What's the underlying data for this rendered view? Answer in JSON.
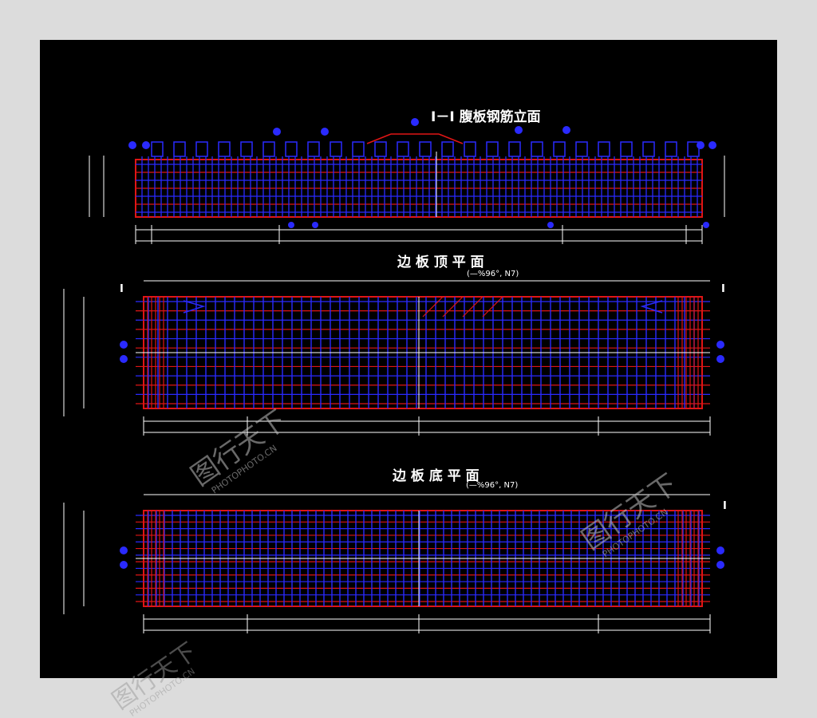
{
  "drawing": {
    "background": "#000000",
    "page_background": "#dcdcdc",
    "colors": {
      "rebar_blue": "#2a2aff",
      "rebar_red": "#e01515",
      "dim_white": "#ffffff",
      "centerline": "#ffffff"
    },
    "views": [
      {
        "id": "elevation",
        "title": "I－I 腹板钢筋立面",
        "subtitle": ""
      },
      {
        "id": "top-plan",
        "title": "边 板 顶 平 面",
        "subtitle": "(—%96°, N7)"
      },
      {
        "id": "bottom-plan",
        "title": "边 板 底 平 面",
        "subtitle": "(—%96°, N7)"
      }
    ],
    "section_marks": [
      "I",
      "I"
    ]
  },
  "watermark": {
    "brand": "图行天下",
    "url": "PHOTOPHOTO.CN"
  }
}
